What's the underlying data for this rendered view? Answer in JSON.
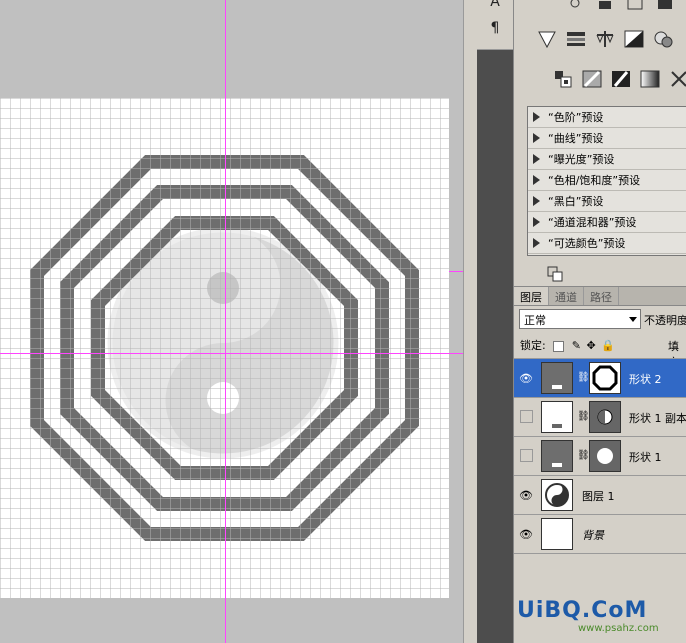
{
  "tools": {
    "paragraph_symbol": "¶"
  },
  "adjustments": {
    "presets": [
      {
        "label": "“色阶”预设"
      },
      {
        "label": "“曲线”预设"
      },
      {
        "label": "“曝光度”预设"
      },
      {
        "label": "“色相/饱和度”预设"
      },
      {
        "label": "“黑白”预设"
      },
      {
        "label": "“通道混和器”预设"
      },
      {
        "label": "“可选颜色”预设"
      }
    ]
  },
  "layers_panel": {
    "tabs": [
      "图层",
      "通道",
      "路径"
    ],
    "blend_mode": "正常",
    "opacity_label": "不透明度",
    "lock_label": "锁定:",
    "fill_label": "填充",
    "layers": [
      {
        "name": "形状 2",
        "visible": true,
        "selected": true
      },
      {
        "name": "形状 1 副本",
        "visible": false,
        "selected": false
      },
      {
        "name": "形状 1",
        "visible": false,
        "selected": false
      },
      {
        "name": "图层 1",
        "visible": true,
        "selected": false
      },
      {
        "name": "背景",
        "visible": true,
        "selected": false
      }
    ]
  },
  "watermark": {
    "text": "UiBQ.CoM",
    "sub": "www.psahz.com"
  },
  "colors": {
    "guide": "#ff44ff",
    "shape": "#6e6e6e",
    "selection": "#3169c6"
  }
}
